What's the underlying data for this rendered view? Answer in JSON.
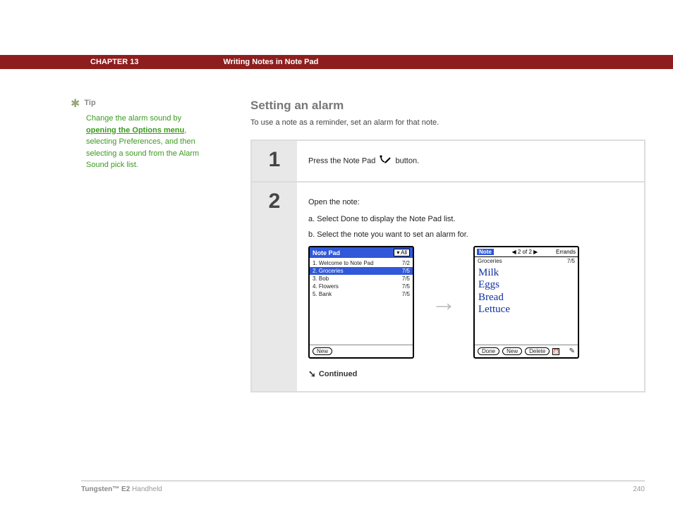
{
  "header": {
    "chapter": "CHAPTER 13",
    "title": "Writing Notes in Note Pad"
  },
  "tip": {
    "label": "Tip",
    "text_before": "Change the alarm sound by ",
    "link": "opening the Options menu",
    "text_after": ", selecting Preferences, and then selecting a sound from the Alarm Sound pick list."
  },
  "section": {
    "title": "Setting an alarm",
    "intro": "To use a note as a reminder, set an alarm for that note."
  },
  "steps": {
    "s1": {
      "num": "1",
      "text_before": "Press the Note Pad ",
      "text_after": "button."
    },
    "s2": {
      "num": "2",
      "open_line": "Open the note:",
      "sub_a": "a.  Select Done to display the Note Pad list.",
      "sub_b": "b.  Select the note you want to set an alarm for.",
      "continued": "Continued"
    }
  },
  "shot_list": {
    "title": "Note Pad",
    "category_dropdown": "▾ All",
    "rows": [
      {
        "label": "1. Welcome to Note Pad",
        "date": "7/2"
      },
      {
        "label": "2. Groceries",
        "date": "7/5"
      },
      {
        "label": "3. Bob",
        "date": "7/5"
      },
      {
        "label": "4. Flowers",
        "date": "7/5"
      },
      {
        "label": "5. Bank",
        "date": "7/5"
      }
    ],
    "new_btn": "New"
  },
  "shot_note": {
    "title_label": "Note",
    "pager": "◀  2 of 2  ▶",
    "category": "Errands",
    "note_title": "Groceries",
    "note_date": "7/5",
    "lines": [
      "Milk",
      "Eggs",
      "Bread",
      "Lettuce"
    ],
    "btn_done": "Done",
    "btn_new": "New",
    "btn_delete": "Delete"
  },
  "footer": {
    "product_bold": "Tungsten™ E2",
    "product_rest": " Handheld",
    "page": "240"
  }
}
